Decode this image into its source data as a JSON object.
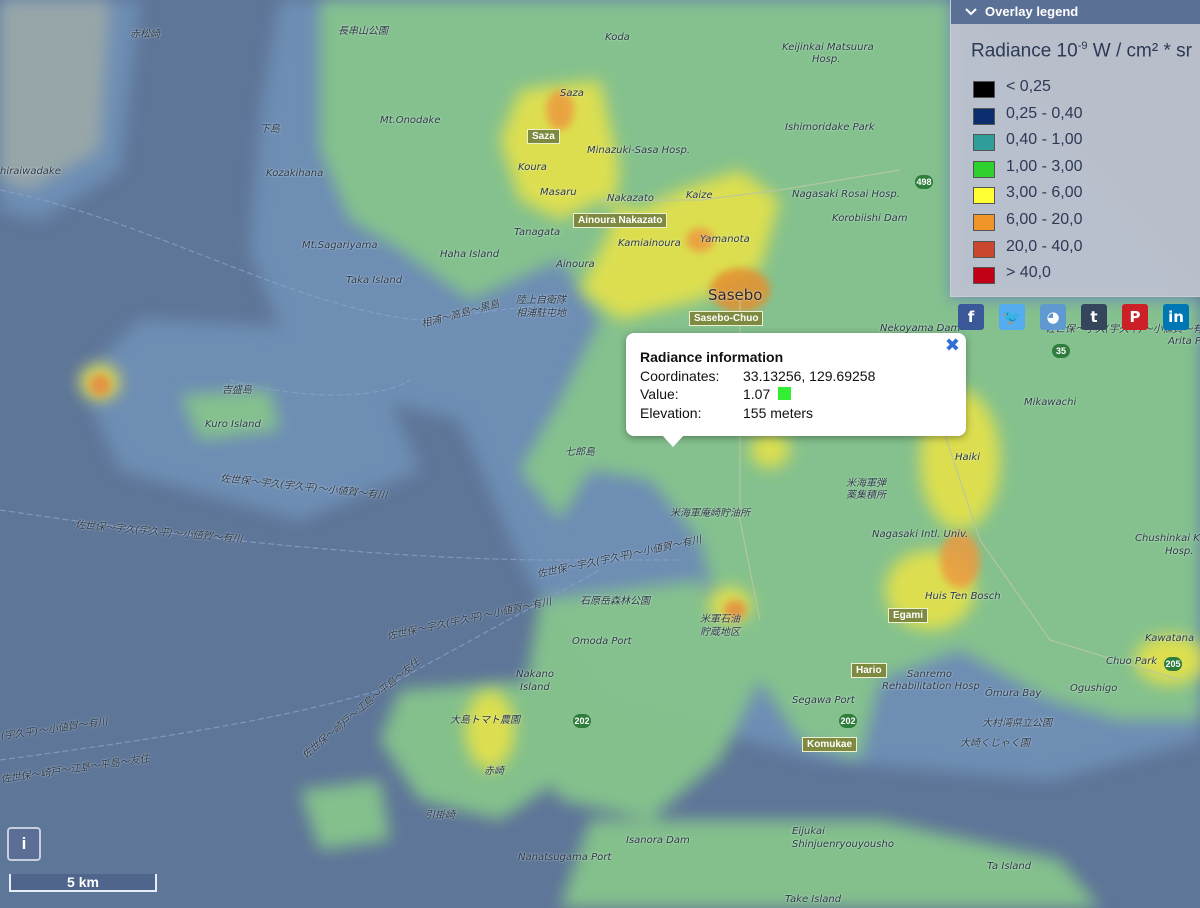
{
  "legend": {
    "header": "Overlay legend",
    "title_main": "Radiance 10",
    "title_exp": "-9",
    "title_rest": " W / cm² * sr",
    "items": [
      {
        "label": "< 0,25",
        "color": "#000000"
      },
      {
        "label": "0,25 - 0,40",
        "color": "#0b2d6e"
      },
      {
        "label": "0,40 - 1,00",
        "color": "#2f9d9a"
      },
      {
        "label": "1,00 - 3,00",
        "color": "#2ed12e"
      },
      {
        "label": "3,00 - 6,00",
        "color": "#ffff33"
      },
      {
        "label": "6,00 - 20,0",
        "color": "#f0952a"
      },
      {
        "label": "20,0 - 40,0",
        "color": "#c9472f"
      },
      {
        "label": " > 40,0",
        "color": "#c00015"
      }
    ]
  },
  "social": [
    {
      "name": "facebook",
      "glyph": "f",
      "color": "#3b5998"
    },
    {
      "name": "twitter",
      "glyph": "🐦",
      "color": "#55acee"
    },
    {
      "name": "reddit",
      "glyph": "◕",
      "color": "#5f99cf"
    },
    {
      "name": "tumblr",
      "glyph": "t",
      "color": "#35465c"
    },
    {
      "name": "pinterest",
      "glyph": "P",
      "color": "#cb2027"
    },
    {
      "name": "linkedin",
      "glyph": "in",
      "color": "#0077b5"
    }
  ],
  "popup": {
    "title": "Radiance information",
    "coord_label": "Coordinates:",
    "coord_value": "33.13256, 129.69258",
    "value_label": "Value:",
    "value": "1.07",
    "value_color": "#33ee33",
    "elevation_label": "Elevation:",
    "elevation_value": "155 meters",
    "close_glyph": "✖"
  },
  "info_button": "i",
  "scale": "5 km",
  "map_labels": [
    "赤松崎",
    "長串山公園",
    "Koda",
    "Keijinkai Matsuura",
    "Hosp.",
    "Saza",
    "Saza",
    "Mt.Onodake",
    "下島",
    "Ishimoridake Park",
    "Minazuki-Sasa Hosp.",
    "Koura",
    "hiraiwadake",
    "Kozakihana",
    "Masaru",
    "Nakazato",
    "Kaize",
    "Nagasaki Rosai Hosp.",
    "Korobiishi Dam",
    "Ainoura Nakazato",
    "Tanagata",
    "Kamiainoura",
    "Yamanota",
    "Mt.Sagariyama",
    "Haha Island",
    "Ainoura",
    "Taka Island",
    "陸上自衛隊",
    "相浦駐屯地",
    "Sasebo",
    "Sasebo-Chuo",
    "Nekoyama Dam",
    "相浦〜高島〜黒島",
    "Arita Po",
    "吉盛島",
    "Kuro Island",
    "Mikawachi",
    "七郎島",
    "Haiki",
    "米海軍弾",
    "薬集積所",
    "佐世保〜宇久(宇久平)〜小値賀〜有川",
    "米海軍庵崎貯油所",
    "Nagasaki Intl. Univ.",
    "Chushinkai K",
    "Hosp.",
    "石原岳森林公園",
    "Huis Ten Bosch",
    "米軍石油",
    "貯蔵地区",
    "Egami",
    "Kawatana",
    "Omoda Port",
    "Nakano",
    "Island",
    "Hario",
    "Sanremo",
    "Rehabilitation Hosp",
    "Chuo Park",
    "Ogushigo",
    "Ōmura Bay",
    "大島トマト農園",
    "Segawa Port",
    "大村湾県立公園",
    "大崎くじゃく園",
    "Komukae",
    "赤崎",
    "引掛崎",
    "Isanora Dam",
    "Eijukai",
    "Shinjuenryouyousho",
    "Nanatsugama Port",
    "Ta Island",
    "Take Island",
    "佐世保〜宇久(宇久平)〜小値賀〜有川",
    "佐世保〜崎戸〜江島〜平島〜友住",
    "(宇久平)〜小値賀〜有川",
    "佐世保〜崎戸〜江島〜平島〜友住",
    "佐世保〜宇久(宇久平)〜小値賀〜有川",
    "佐世保〜宇久(宇久平)〜小値賀〜有川",
    "佐世保〜宇久(宇久平)〜小値賀〜有川"
  ],
  "routes": [
    "498",
    "35",
    "202",
    "202",
    "205"
  ]
}
